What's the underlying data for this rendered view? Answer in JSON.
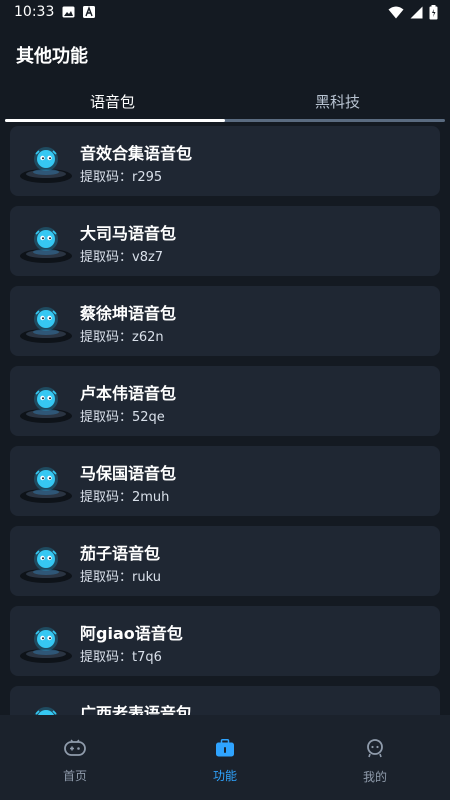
{
  "status_bar": {
    "time": "10:33",
    "left_icons": [
      "image-icon",
      "font-icon"
    ],
    "right_icons": [
      "wifi-icon",
      "signal-icon",
      "battery-icon"
    ]
  },
  "header": {
    "title": "其他功能"
  },
  "tabs": [
    {
      "label": "语音包",
      "active": true
    },
    {
      "label": "黑科技",
      "active": false
    }
  ],
  "voice_packs": [
    {
      "name": "音效合集语音包",
      "code": "提取码：r295"
    },
    {
      "name": "大司马语音包",
      "code": "提取码：v8z7"
    },
    {
      "name": "蔡徐坤语音包",
      "code": "提取码：z62n"
    },
    {
      "name": "卢本伟语音包",
      "code": "提取码：52qe"
    },
    {
      "name": "马保国语音包",
      "code": "提取码：2muh"
    },
    {
      "name": "茄子语音包",
      "code": "提取码：ruku"
    },
    {
      "name": "阿giao语音包",
      "code": "提取码：t7q6"
    },
    {
      "name": "广西老表语音包",
      "code": ""
    }
  ],
  "bottom_nav": [
    {
      "label": "首页",
      "icon": "gamepad-icon",
      "active": false
    },
    {
      "label": "功能",
      "icon": "toolbox-icon",
      "active": true
    },
    {
      "label": "我的",
      "icon": "robot-icon",
      "active": false
    }
  ],
  "colors": {
    "background": "#141a22",
    "card": "#1f2733",
    "accent": "#2fa4ff",
    "bottom_nav": "#1b222c"
  }
}
